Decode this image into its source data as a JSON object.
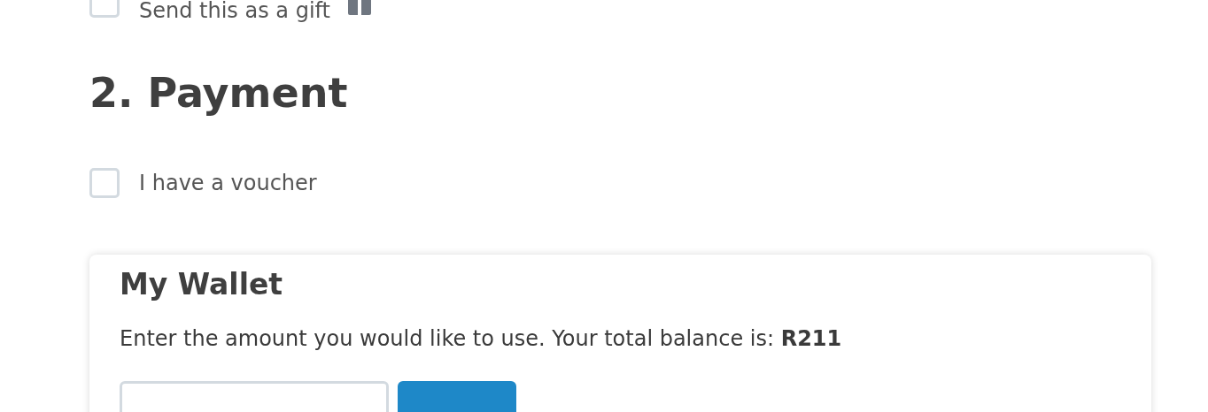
{
  "gift_option": {
    "label": "Send this as a gift",
    "checked": false
  },
  "section": {
    "title": "2. Payment"
  },
  "voucher_option": {
    "label": "I have a voucher",
    "checked": false
  },
  "wallet": {
    "title": "My Wallet",
    "description": "Enter the amount you would like to use. Your total balance is: **R211**"
  }
}
